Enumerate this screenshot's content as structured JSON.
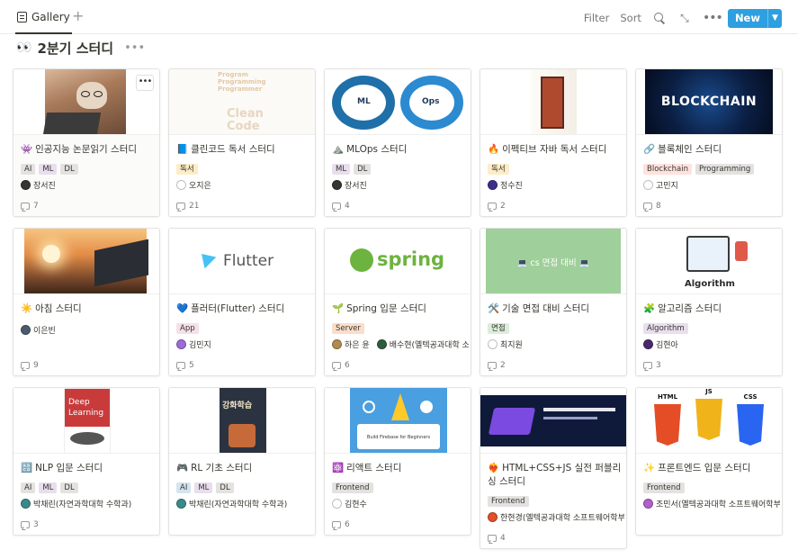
{
  "toolbar": {
    "view_label": "Gallery",
    "add_view": "+",
    "filter_label": "Filter",
    "sort_label": "Sort",
    "new_label": "New",
    "accent": "#2e9fe0"
  },
  "page": {
    "emoji": "👀",
    "title": "2분기 스터디",
    "more": "•••"
  },
  "cards": [
    {
      "emoji": "👾",
      "title": "인공지능 논문읽기 스터디",
      "tags": [
        {
          "label": "AI",
          "color": "#e3e2e0"
        },
        {
          "label": "ML",
          "color": "#e8deee"
        },
        {
          "label": "DL",
          "color": "#e3e2e0"
        }
      ],
      "people": [
        {
          "name": "장서진",
          "avatar": "#37352f"
        }
      ],
      "comments": "7"
    },
    {
      "emoji": "📘",
      "title": "클린코드 독서 스터디",
      "tags": [
        {
          "label": "독서",
          "color": "#fdecc8"
        }
      ],
      "people": [
        {
          "name": "오지은",
          "avatar": "#ffffff"
        }
      ],
      "comments": "21"
    },
    {
      "emoji": "⛰️",
      "title": "MLOps 스터디",
      "tags": [
        {
          "label": "ML",
          "color": "#e8deee"
        },
        {
          "label": "DL",
          "color": "#e3e2e0"
        }
      ],
      "people": [
        {
          "name": "장서진",
          "avatar": "#37352f"
        }
      ],
      "comments": "4"
    },
    {
      "emoji": "🔥",
      "title": "이펙티브 자바 독서 스터디",
      "tags": [
        {
          "label": "독서",
          "color": "#fdecc8"
        }
      ],
      "people": [
        {
          "name": "정수진",
          "avatar": "#3f2d8c"
        }
      ],
      "comments": "2"
    },
    {
      "emoji": "🔗",
      "title": "블록체인 스터디",
      "tags": [
        {
          "label": "Blockchain",
          "color": "#ffe2dd"
        },
        {
          "label": "Programming",
          "color": "#e3e2e0"
        }
      ],
      "people": [
        {
          "name": "고민지",
          "avatar": "#ffffff"
        }
      ],
      "comments": "8"
    },
    {
      "emoji": "☀️",
      "title": "아침 스터디",
      "tags": [],
      "people": [
        {
          "name": "이은빈",
          "avatar": "#4b5b6b"
        }
      ],
      "comments": "9"
    },
    {
      "emoji": "💙",
      "title": "플러터(Flutter) 스터디",
      "tags": [
        {
          "label": "App",
          "color": "#f5e0e9"
        }
      ],
      "people": [
        {
          "name": "김민지",
          "avatar": "#9b6bd6"
        }
      ],
      "comments": "5"
    },
    {
      "emoji": "🌱",
      "title": "Spring 입문 스터디",
      "tags": [
        {
          "label": "Server",
          "color": "#fadec9"
        }
      ],
      "people": [
        {
          "name": "하은 윤",
          "avatar": "#b08a50"
        },
        {
          "name": "배수현(옐텍공과대학 소프트웨어학부)",
          "avatar": "#2f5e3e"
        }
      ],
      "comments": "6"
    },
    {
      "emoji": "🛠️",
      "title": "기술 면접 대비 스터디",
      "tags": [
        {
          "label": "면접",
          "color": "#dbeddb"
        }
      ],
      "people": [
        {
          "name": "최지원",
          "avatar": "#ffffff"
        }
      ],
      "comments": "2"
    },
    {
      "emoji": "🧩",
      "title": "알고리즘 스터디",
      "tags": [
        {
          "label": "Algorithm",
          "color": "#e8deee"
        }
      ],
      "people": [
        {
          "name": "김현아",
          "avatar": "#4a2a6a"
        }
      ],
      "comments": "3"
    },
    {
      "emoji": "🔠",
      "title": "NLP 입문 스터디",
      "tags": [
        {
          "label": "AI",
          "color": "#e3e2e0"
        },
        {
          "label": "ML",
          "color": "#e8deee"
        },
        {
          "label": "DL",
          "color": "#e3e2e0"
        }
      ],
      "people": [
        {
          "name": "박채린(자연과학대학 수학과)",
          "avatar": "#3a8a8a"
        }
      ],
      "comments": "3"
    },
    {
      "emoji": "🎮",
      "title": "RL 기초 스터디",
      "tags": [
        {
          "label": "AI",
          "color": "#d3e5ef"
        },
        {
          "label": "ML",
          "color": "#e8deee"
        },
        {
          "label": "DL",
          "color": "#e3e2e0"
        }
      ],
      "people": [
        {
          "name": "박채린(자연과학대학 수학과)",
          "avatar": "#3a8a8a"
        }
      ],
      "comments": ""
    },
    {
      "emoji": "⚛️",
      "title": "리액트 스터디",
      "tags": [
        {
          "label": "Frontend",
          "color": "#e3e2e0"
        }
      ],
      "people": [
        {
          "name": "김현수",
          "avatar": "#ffffff"
        }
      ],
      "comments": "6"
    },
    {
      "emoji": "❤️‍🔥",
      "title": "HTML+CSS+JS 실전 퍼블리싱 스터디",
      "tags": [
        {
          "label": "Frontend",
          "color": "#e3e2e0"
        }
      ],
      "people": [
        {
          "name": "한현경(옐텍공과대학 소프트웨어학부)",
          "avatar": "#e0502a"
        }
      ],
      "comments": "4"
    },
    {
      "emoji": "✨",
      "title": "프론트엔드 입문 스터디",
      "tags": [
        {
          "label": "Frontend",
          "color": "#e3e2e0"
        }
      ],
      "people": [
        {
          "name": "조민서(옐텍공과대학 소프트웨어학부)",
          "avatar": "#b060c8"
        }
      ],
      "comments": ""
    }
  ],
  "covers": {
    "clean_code": [
      "Program",
      "Programming",
      "Programmer",
      "Clean",
      "Code"
    ],
    "mlops": [
      "ML",
      "Ops"
    ],
    "blockchain": "BLOCKCHAIN",
    "flutter": "Flutter",
    "spring": "spring",
    "interview": "💻 cs 면접 대비 💻",
    "algorithm": "Algorithm",
    "deep_learning": [
      "Deep",
      "Learning"
    ],
    "rl_book": "강화학습",
    "firebase": "Build Firebase for Beginners",
    "html_badges": [
      "HTML",
      "CSS",
      "JS"
    ]
  }
}
